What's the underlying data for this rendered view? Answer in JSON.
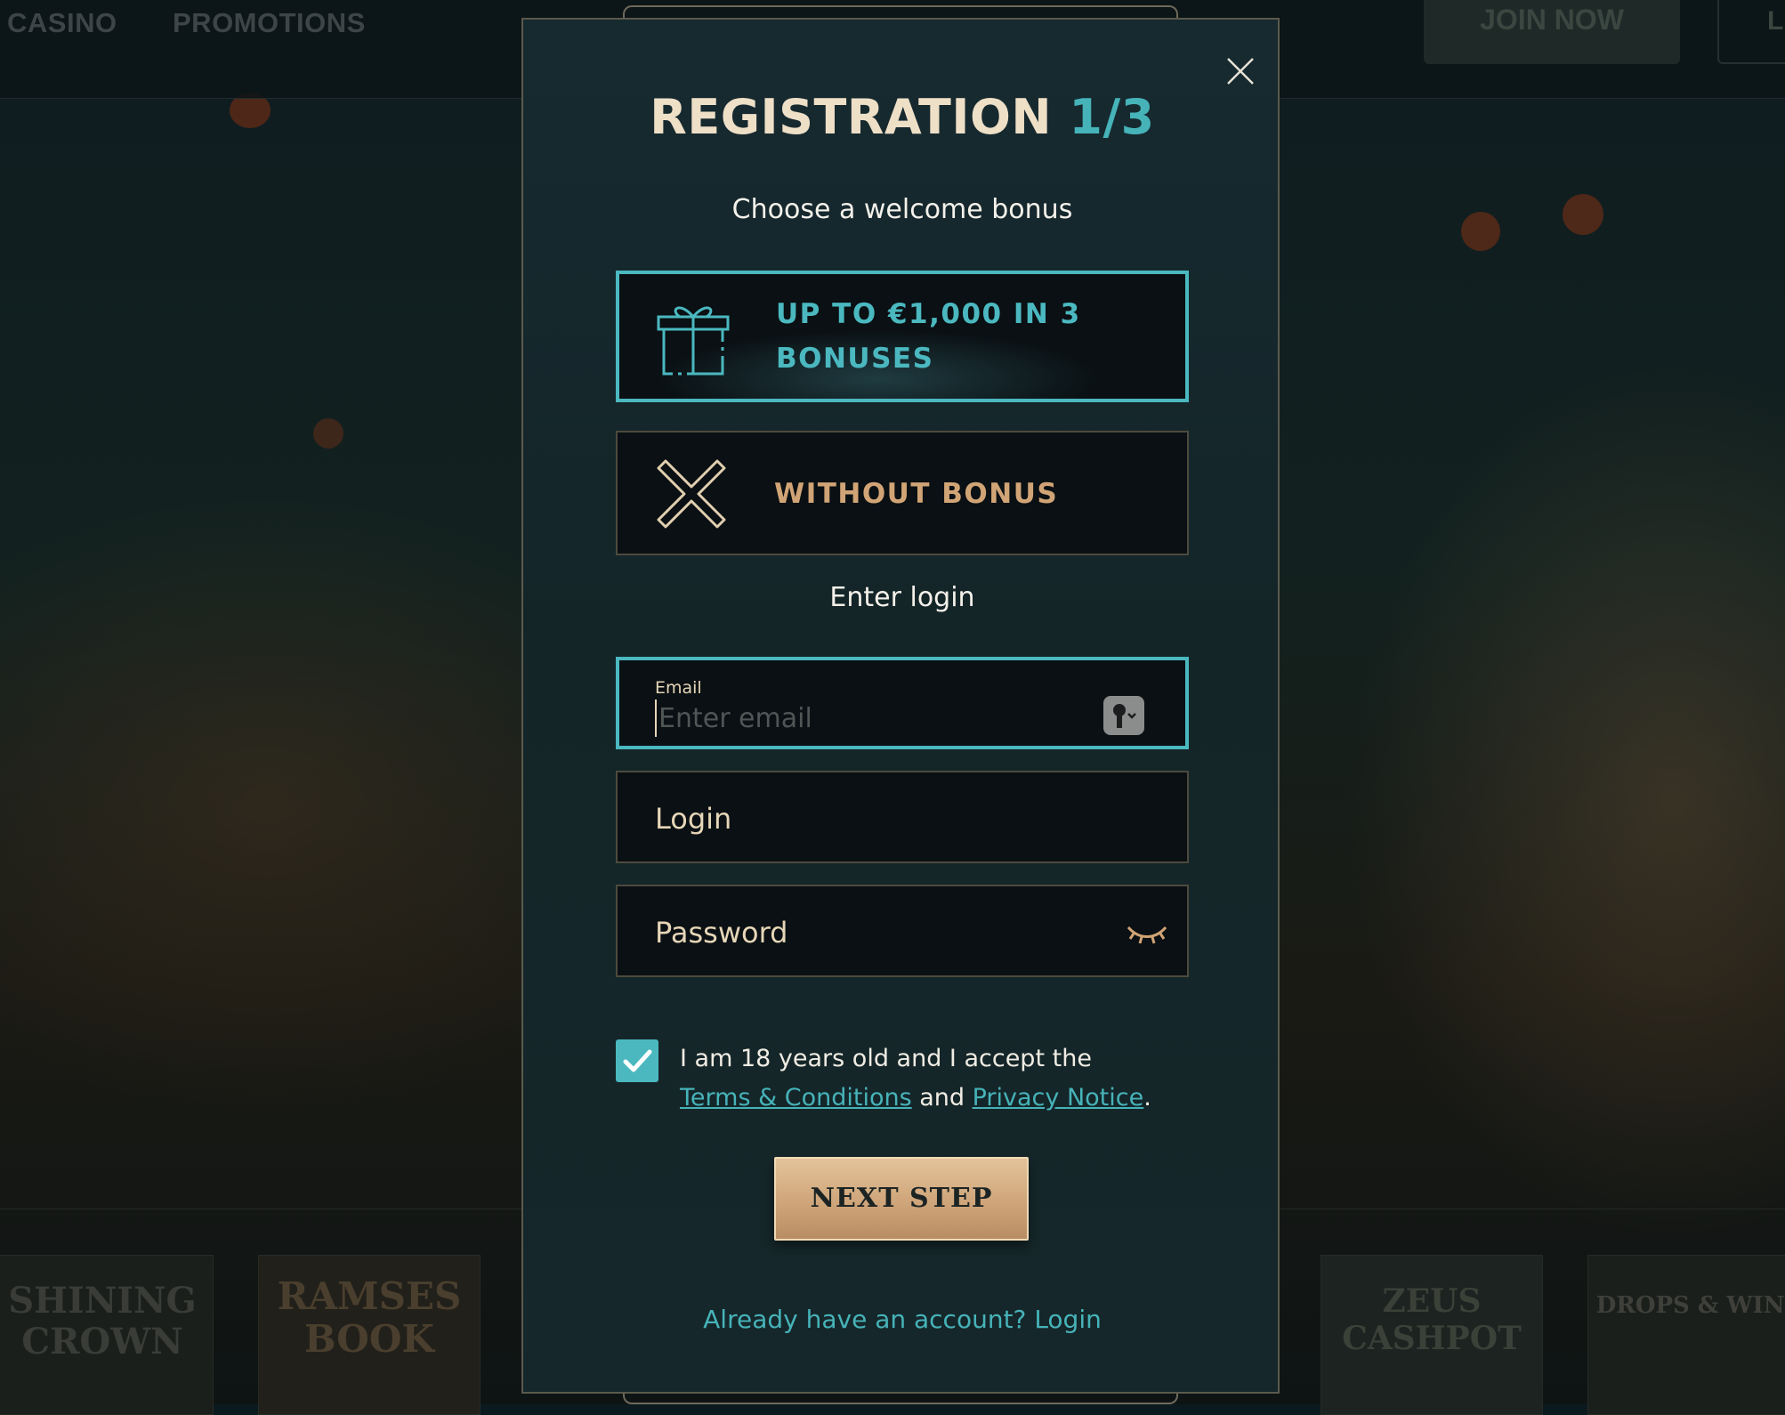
{
  "background": {
    "nav": {
      "casino": "CASINO",
      "promotions": "PROMOTIONS",
      "join": "JOIN NOW",
      "login_partial": "L"
    },
    "games": [
      {
        "title": "SHINING CROWN"
      },
      {
        "title": "RAMSES BOOK"
      },
      {
        "title": "ZEUS CASHPOT"
      },
      {
        "title": "DROPS & WINS"
      }
    ]
  },
  "modal": {
    "title": "REGISTRATION",
    "step": "1/3",
    "bonus_heading": "Choose a welcome bonus",
    "bonus_option": {
      "line1": "UP TO €1,000 IN 3",
      "line2": "BONUSES",
      "icon": "gift-icon"
    },
    "no_bonus_option": {
      "label": "WITHOUT BONUS",
      "icon": "x-icon"
    },
    "login_heading": "Enter login",
    "email": {
      "label": "Email",
      "placeholder": "Enter email"
    },
    "login": {
      "placeholder": "Login"
    },
    "password": {
      "placeholder": "Password",
      "icon": "eye-closed-icon"
    },
    "terms": {
      "text": "I am 18 years old and I accept the",
      "terms_link": "Terms & Conditions",
      "and": "and",
      "privacy_link": "Privacy Notice",
      "period": ".",
      "checked": true
    },
    "next_button": "NEXT STEP",
    "login_link": "Already have an account? Login"
  },
  "colors": {
    "accent": "#4bb8c0",
    "gold": "#d1a476",
    "cream": "#eedfc7"
  }
}
